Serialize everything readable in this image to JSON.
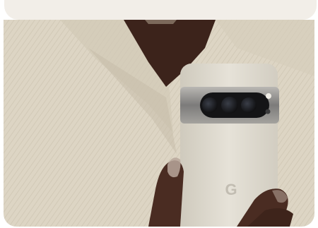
{
  "card": {
    "background": "#f2eee8"
  },
  "photo": {
    "colors": {
      "fabric": "#ddd5c4",
      "fabric_shadow": "#c7bda9",
      "skin": "#4a2c22",
      "phone_body": "#dcd8cd",
      "camera_bar": "#8f8e8d",
      "lens": "#1c1c1e"
    },
    "logo": "G"
  }
}
